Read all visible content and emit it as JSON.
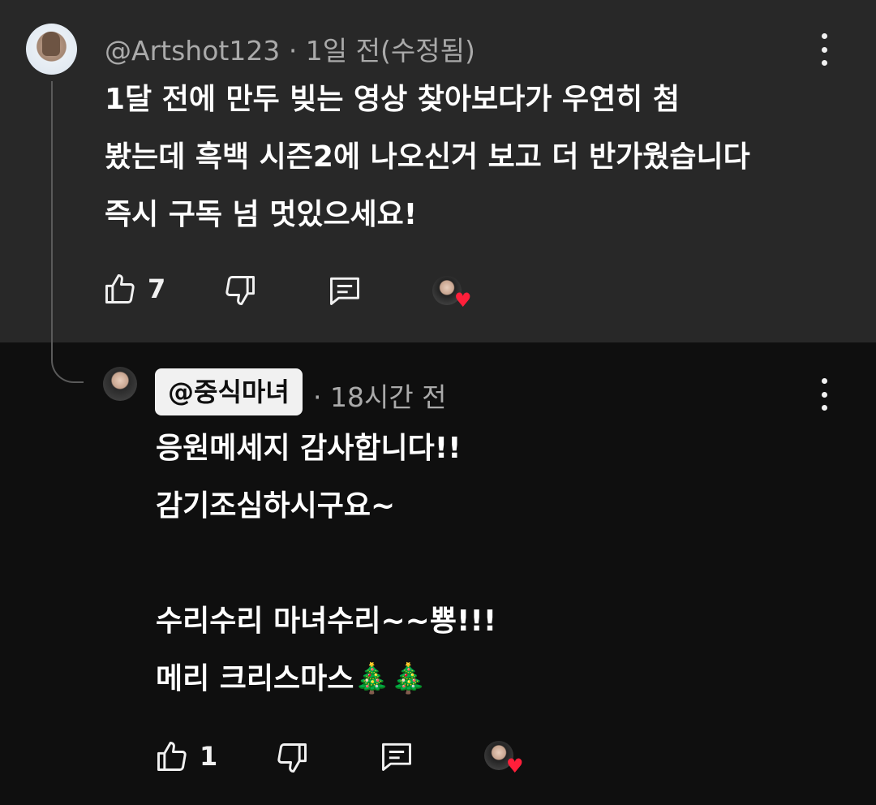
{
  "comment": {
    "author": "@Artshot123",
    "time": "· 1일 전(수정됨)",
    "lines": [
      "1달 전에 만두 빚는 영상 찾아보다가 우연히 첨",
      "봤는데 흑백 시즌2에 나오신거 보고 더 반가웠습니다",
      "즉시 구독 넘 멋있으세요!"
    ],
    "like_count": "7",
    "heart_icon": "♥"
  },
  "reply": {
    "author": "@중식마녀",
    "time": "· 18시간 전",
    "lines": [
      "응원메세지 감사합니다!!",
      "감기조심하시구요~",
      "",
      "수리수리 마녀수리~~뿅!!!",
      "메리 크리스마스🎄🎄"
    ],
    "like_count": "1",
    "heart_icon": "♥"
  },
  "colors": {
    "top_background": "#282828",
    "reply_background": "#0f0f0f",
    "heart": "#ff1f3a",
    "meta_text": "#aaaaaa"
  }
}
